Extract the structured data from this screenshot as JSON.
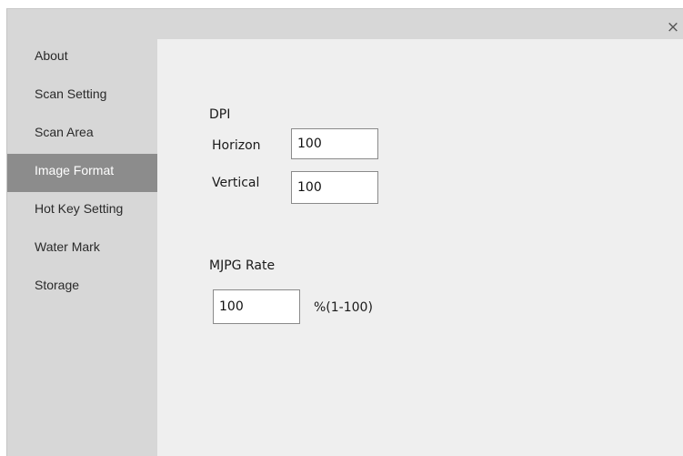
{
  "window": {
    "close_glyph": "×"
  },
  "sidebar": {
    "items": [
      {
        "label": "About",
        "active": false
      },
      {
        "label": "Scan Setting",
        "active": false
      },
      {
        "label": "Scan Area",
        "active": false
      },
      {
        "label": "Image Format",
        "active": true
      },
      {
        "label": "Hot Key Setting",
        "active": false
      },
      {
        "label": "Water Mark",
        "active": false
      },
      {
        "label": "Storage",
        "active": false
      }
    ]
  },
  "dpi": {
    "heading": "DPI",
    "horizontal_label": "Horizon",
    "horizontal_value": "100",
    "vertical_label": "Vertical",
    "vertical_value": "100"
  },
  "mjpg": {
    "heading": "MJPG Rate",
    "value": "100",
    "range_hint": "%(1-100)"
  },
  "colors": {
    "active_item_bg": "#8c8c8c",
    "sidebar_bg": "#d7d7d7",
    "content_bg": "#efefef"
  }
}
